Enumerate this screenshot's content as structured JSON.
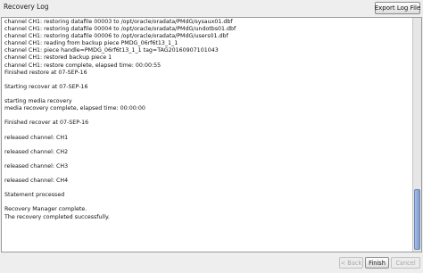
{
  "header": {
    "title": "Recovery Log",
    "export_label": "Export Log File"
  },
  "log": {
    "lines": [
      "channel CH1: restoring datafile 00003 to /opt/oracle/oradata/PMdG/sysaux01.dbf",
      "channel CH1: restoring datafile 00004 to /opt/oracle/oradata/PMdG/undotbs01.dbf",
      "channel CH1: restoring datafile 00006 to /opt/oracle/oradata/PMdG/users01.dbf",
      "channel CH1: reading from backup piece PMDG_06rf6t13_1_1",
      "channel CH1: piece handle=PMDG_06rf6t13_1_1 tag=TAG20160907101043",
      "channel CH1: restored backup piece 1",
      "channel CH1: restore complete, elapsed time: 00:00:55",
      "Finished restore at 07-SEP-16",
      "",
      "Starting recover at 07-SEP-16",
      "",
      "starting media recovery",
      "media recovery complete, elapsed time: 00:00:00",
      "",
      "Finished recover at 07-SEP-16",
      "",
      "released channel: CH1",
      "",
      "released channel: CH2",
      "",
      "released channel: CH3",
      "",
      "released channel: CH4",
      "",
      "Statement processed",
      "",
      "Recovery Manager complete.",
      "The recovery completed successfully."
    ]
  },
  "footer": {
    "back_label": "< Back",
    "finish_label": "Finish",
    "cancel_label": "Cancel"
  }
}
